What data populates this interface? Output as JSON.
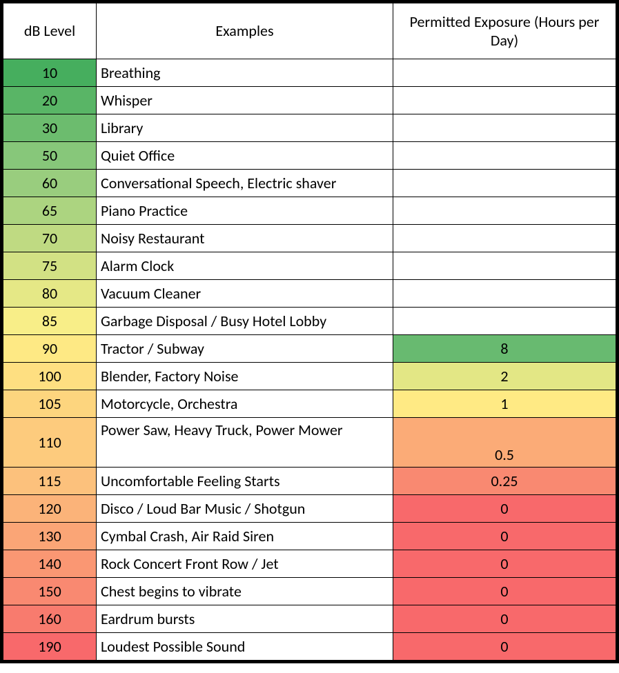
{
  "headers": {
    "db": "dB Level",
    "examples": "Examples",
    "exposure": "Permitted Exposure (Hours per Day)"
  },
  "rows": [
    {
      "db": "10",
      "db_color": "#46AE5E",
      "example": "Breathing",
      "exposure": "",
      "exp_color": ""
    },
    {
      "db": "20",
      "db_color": "#59B566",
      "example": "Whisper",
      "exposure": "",
      "exp_color": ""
    },
    {
      "db": "30",
      "db_color": "#6CBC6E",
      "example": "Library",
      "exposure": "",
      "exp_color": ""
    },
    {
      "db": "50",
      "db_color": "#87C77A",
      "example": "Quiet Office",
      "exposure": "",
      "exp_color": ""
    },
    {
      "db": "60",
      "db_color": "#99CD7E",
      "example": "Conversational Speech, Electric shaver",
      "exposure": "",
      "exp_color": ""
    },
    {
      "db": "65",
      "db_color": "#ACD480",
      "example": "Piano Practice",
      "exposure": "",
      "exp_color": ""
    },
    {
      "db": "70",
      "db_color": "#BFDA82",
      "example": "Noisy Restaurant",
      "exposure": "",
      "exp_color": ""
    },
    {
      "db": "75",
      "db_color": "#D2E184",
      "example": "Alarm Clock",
      "exposure": "",
      "exp_color": ""
    },
    {
      "db": "80",
      "db_color": "#E5E886",
      "example": "Vacuum Cleaner",
      "exposure": "",
      "exp_color": ""
    },
    {
      "db": "85",
      "db_color": "#F8EE88",
      "example": "Garbage Disposal / Busy Hotel Lobby",
      "exposure": "",
      "exp_color": ""
    },
    {
      "db": "90",
      "db_color": "#FEE984",
      "example": "Tractor / Subway",
      "exposure": "8",
      "exp_color": "#68BA70"
    },
    {
      "db": "100",
      "db_color": "#FEDF81",
      "example": "Blender, Factory Noise",
      "exposure": "2",
      "exp_color": "#E3E785"
    },
    {
      "db": "105",
      "db_color": "#FDD57E",
      "example": "Motorcycle, Orchestra",
      "exposure": "1",
      "exp_color": "#FFEA84"
    },
    {
      "db": "110",
      "db_color": "#FDCB7D",
      "example": "Power Saw, Heavy Truck, Power Mower",
      "exposure": "0.5",
      "exp_color": "#FBAB77",
      "tall": true
    },
    {
      "db": "115",
      "db_color": "#FCC17C",
      "example": "Uncomfortable Feeling Starts",
      "exposure": "0.25",
      "exp_color": "#F98971"
    },
    {
      "db": "120",
      "db_color": "#FBB379",
      "example": "Disco / Loud Bar Music / Shotgun",
      "exposure": "0",
      "exp_color": "#F8696B"
    },
    {
      "db": "130",
      "db_color": "#FAA576",
      "example": "Cymbal Crash, Air Raid Siren",
      "exposure": "0",
      "exp_color": "#F8696B"
    },
    {
      "db": "140",
      "db_color": "#FA9773",
      "example": "Rock Concert Front Row / Jet",
      "exposure": "0",
      "exp_color": "#F8696B"
    },
    {
      "db": "150",
      "db_color": "#F98971",
      "example": "Chest begins to vibrate",
      "exposure": "0",
      "exp_color": "#F8696B"
    },
    {
      "db": "160",
      "db_color": "#F87B6E",
      "example": "Eardrum bursts",
      "exposure": "0",
      "exp_color": "#F8696B"
    },
    {
      "db": "190",
      "db_color": "#F8696B",
      "example": "Loudest Possible Sound",
      "exposure": "0",
      "exp_color": "#F8696B"
    }
  ],
  "chart_data": {
    "type": "table",
    "title": "dB Level vs Permitted Exposure",
    "columns": [
      "dB Level",
      "Examples",
      "Permitted Exposure (Hours per Day)"
    ],
    "rows": [
      [
        10,
        "Breathing",
        null
      ],
      [
        20,
        "Whisper",
        null
      ],
      [
        30,
        "Library",
        null
      ],
      [
        50,
        "Quiet Office",
        null
      ],
      [
        60,
        "Conversational Speech, Electric shaver",
        null
      ],
      [
        65,
        "Piano Practice",
        null
      ],
      [
        70,
        "Noisy Restaurant",
        null
      ],
      [
        75,
        "Alarm Clock",
        null
      ],
      [
        80,
        "Vacuum Cleaner",
        null
      ],
      [
        85,
        "Garbage Disposal / Busy Hotel Lobby",
        null
      ],
      [
        90,
        "Tractor / Subway",
        8
      ],
      [
        100,
        "Blender, Factory Noise",
        2
      ],
      [
        105,
        "Motorcycle, Orchestra",
        1
      ],
      [
        110,
        "Power Saw, Heavy Truck, Power Mower",
        0.5
      ],
      [
        115,
        "Uncomfortable Feeling Starts",
        0.25
      ],
      [
        120,
        "Disco / Loud Bar Music / Shotgun",
        0
      ],
      [
        130,
        "Cymbal Crash, Air Raid Siren",
        0
      ],
      [
        140,
        "Rock Concert Front Row / Jet",
        0
      ],
      [
        150,
        "Chest begins to vibrate",
        0
      ],
      [
        160,
        "Eardrum bursts",
        0
      ],
      [
        190,
        "Loudest Possible Sound",
        0
      ]
    ]
  }
}
